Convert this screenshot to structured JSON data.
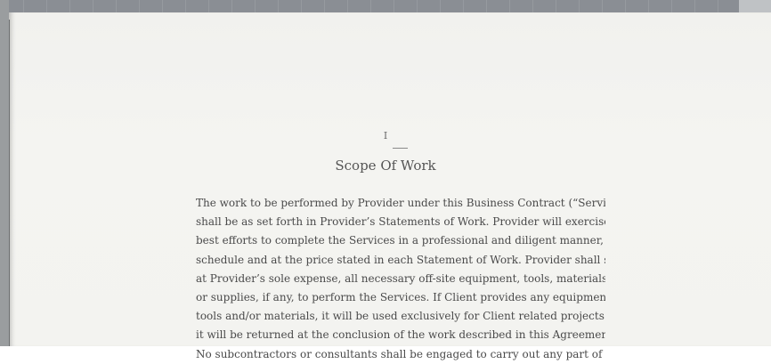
{
  "chapter": {
    "number": "I",
    "title": "Scope Of Work"
  },
  "body": {
    "lines": [
      "The work to be performed by Provider under this Business Contract (“Services”)",
      "shall be as set forth in Provider’s Statements of Work. Provider will exercise its",
      "best efforts to complete the Services in a professional and diligent manner, on the",
      "schedule and at the price stated in each Statement of Work. Provider shall supply,",
      "at Provider’s sole expense, all necessary off-site equipment, tools, materials, and/",
      "or supplies, if any, to perform the Services. If Client provides any equipment,",
      "tools and/or materials, it will be used exclusively for Client related projects and",
      "it will be returned at the conclusion of the work described in this Agreement.",
      "No subcontractors or consultants shall be engaged to carry out any part of the"
    ]
  }
}
